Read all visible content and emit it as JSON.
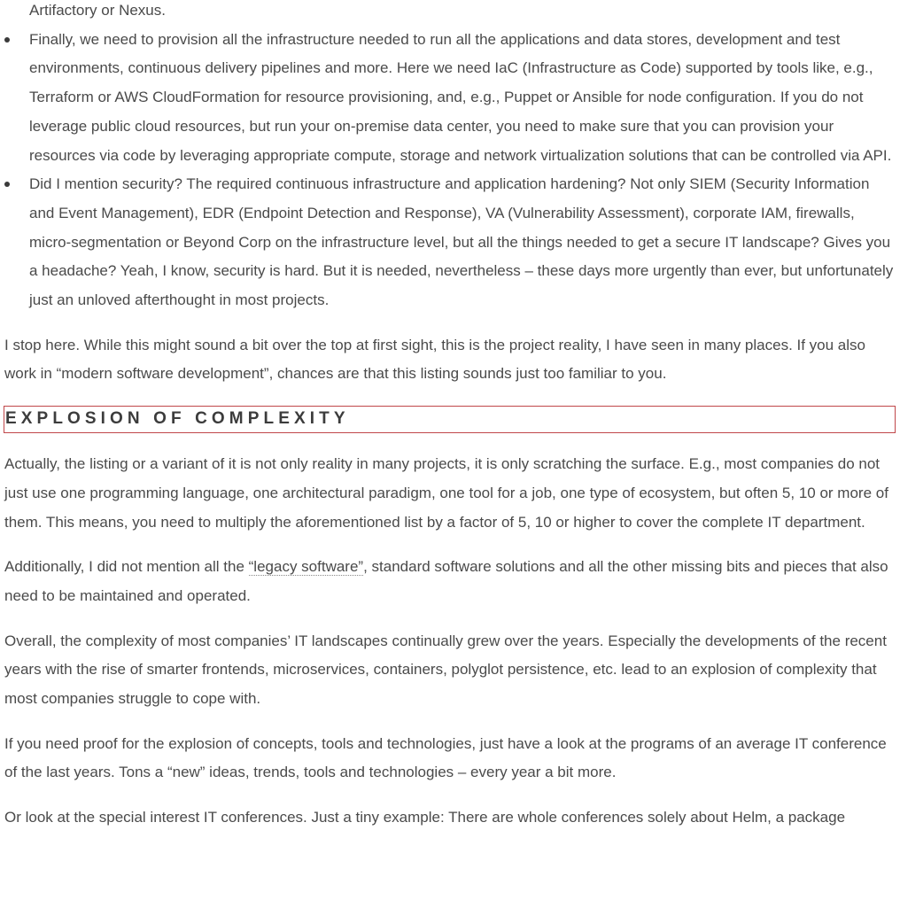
{
  "top_line": "Artifactory or Nexus.",
  "bullets": [
    "Finally, we need to provision all the infrastructure needed to run all the applications and data stores, development and test environments, continuous delivery pipelines and more. Here we need IaC (Infrastructure as Code) supported by tools like, e.g., Terraform or AWS CloudFormation for resource provisioning, and, e.g., Puppet or Ansible for node configuration. If you do not leverage public cloud resources, but run your on-premise data center, you need to make sure that you can provision your resources via code by leveraging appropriate compute, storage and network virtualization solutions that can be controlled via API.",
    "Did I mention security? The required continuous infrastructure and application hardening? Not only SIEM (Security Information and Event Management), EDR (Endpoint Detection and Response), VA (Vulnerability Assessment), corporate IAM, firewalls, micro-segmentation or Beyond Corp on the infrastructure level, but all the things needed to get a secure IT landscape? Gives you a headache? Yeah, I know, security is hard. But it is needed, nevertheless – these days more urgently than ever, but unfortunately just an unloved afterthought in most projects."
  ],
  "para_stop": "I stop here. While this might sound a bit over the top at first sight, this is the project reality, I have seen in many places. If you also work in “modern software development”, chances are that this listing sounds just too familiar to you.",
  "heading": "EXPLOSION OF COMPLEXITY",
  "para_actually": "Actually, the listing or a variant of it is not only reality in many projects, it is only scratching the surface. E.g., most companies do not just use one programming language, one architectural paradigm, one tool for a job, one type of ecosystem, but often 5, 10 or more of them. This means, you need to multiply the aforementioned list by a factor of 5, 10 or higher to cover the complete IT department.",
  "para_additionally": {
    "before": "Additionally, I did not mention all the ",
    "link": "“legacy software”",
    "after": ", standard software solutions and all the other missing bits and pieces that also need to be maintained and operated."
  },
  "para_overall": "Overall, the complexity of most companies’ IT landscapes continually grew over the years. Especially the developments of the recent years with the rise of smarter frontends, microservices, containers, polyglot persistence, etc. lead to an explosion of complexity that most companies struggle to cope with.",
  "para_proof": "If you need proof for the explosion of concepts, tools and technologies, just have a look at the programs of an average IT conference of the last years. Tons a “new” ideas, trends, tools and technologies – every year a bit more.",
  "para_special": "Or look at the special interest IT conferences. Just a tiny example: There are whole conferences solely about Helm, a package",
  "colors": {
    "text": "#4a4a4a",
    "heading_border": "#c0474a",
    "heading_text": "#3c3c3c"
  }
}
